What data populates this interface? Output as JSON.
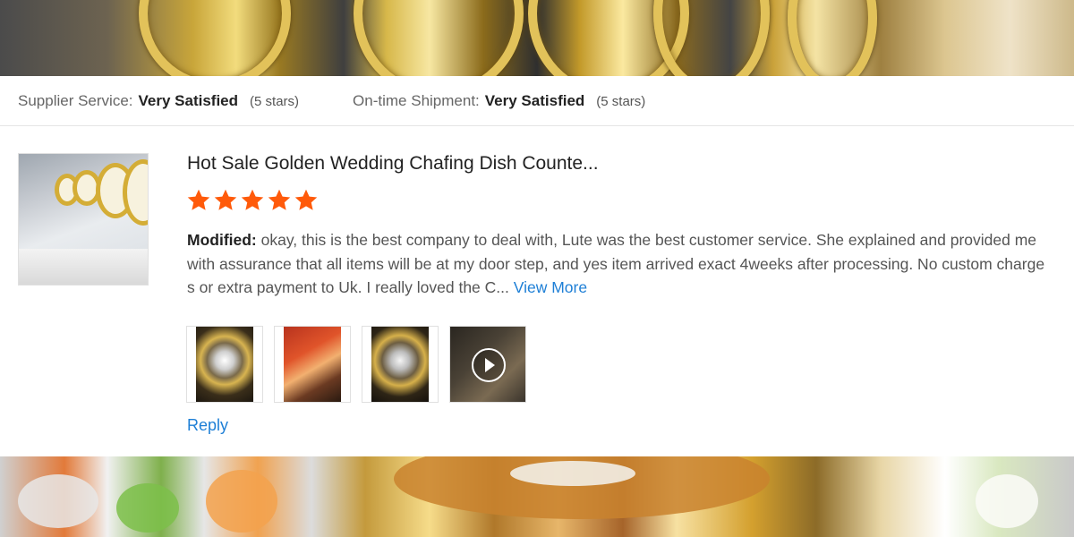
{
  "summary": {
    "supplier_label": "Supplier Service:",
    "supplier_value": "Very Satisfied",
    "supplier_stars": "(5 stars)",
    "shipment_label": "On-time Shipment:",
    "shipment_value": "Very Satisfied",
    "shipment_stars": "(5 stars)"
  },
  "review": {
    "product_title": "Hot Sale Golden Wedding Chafing Dish Counte...",
    "rating": 5,
    "rating_max": 5,
    "star_color": "#ff5a0a",
    "modified_label": "Modified:",
    "text": " okay, this is the best company to deal with, Lute was the best customer service. She explained and provided me with assurance that all items will be at my door step, and yes item arrived exact 4weeks after processing. No custom charges or extra payment to Uk. I really loved the C...",
    "view_more": "View More",
    "media": [
      {
        "type": "image",
        "icon": "photo"
      },
      {
        "type": "image",
        "icon": "photo"
      },
      {
        "type": "image",
        "icon": "photo"
      },
      {
        "type": "video",
        "icon": "play-icon"
      }
    ],
    "reply_label": "Reply"
  },
  "colors": {
    "link": "#1e7fd6",
    "accent_star": "#ff5a0a"
  }
}
